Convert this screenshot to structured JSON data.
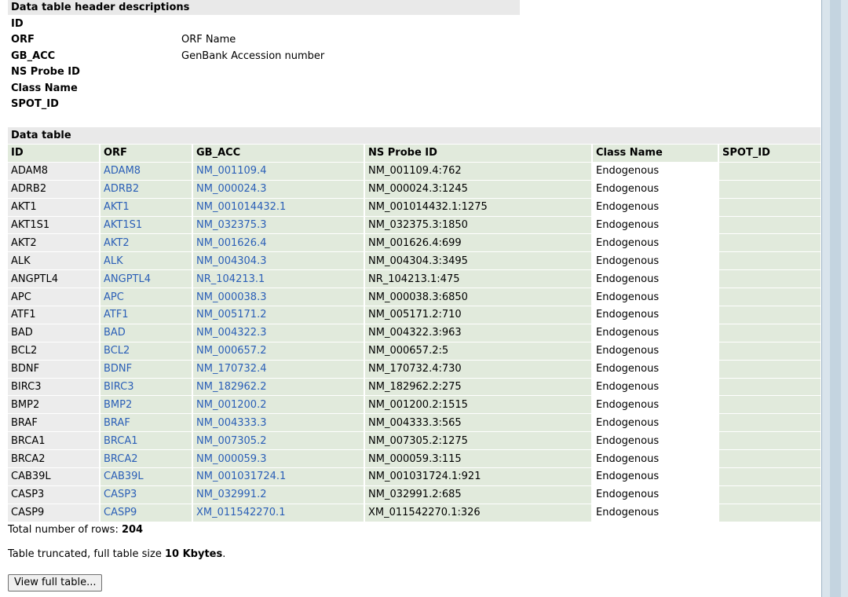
{
  "header_desc": {
    "title": "Data table header descriptions",
    "items": [
      {
        "key": "ID",
        "value": ""
      },
      {
        "key": "ORF",
        "value": "ORF Name"
      },
      {
        "key": "GB_ACC",
        "value": "GenBank Accession number"
      },
      {
        "key": "NS Probe ID",
        "value": ""
      },
      {
        "key": "Class Name",
        "value": ""
      },
      {
        "key": "SPOT_ID",
        "value": ""
      }
    ]
  },
  "data_table": {
    "title": "Data table",
    "columns": [
      "ID",
      "ORF",
      "GB_ACC",
      "NS Probe ID",
      "Class Name",
      "SPOT_ID"
    ],
    "rows": [
      [
        "ADAM8",
        "ADAM8",
        "NM_001109.4",
        "NM_001109.4:762",
        "Endogenous",
        ""
      ],
      [
        "ADRB2",
        "ADRB2",
        "NM_000024.3",
        "NM_000024.3:1245",
        "Endogenous",
        ""
      ],
      [
        "AKT1",
        "AKT1",
        "NM_001014432.1",
        "NM_001014432.1:1275",
        "Endogenous",
        ""
      ],
      [
        "AKT1S1",
        "AKT1S1",
        "NM_032375.3",
        "NM_032375.3:1850",
        "Endogenous",
        ""
      ],
      [
        "AKT2",
        "AKT2",
        "NM_001626.4",
        "NM_001626.4:699",
        "Endogenous",
        ""
      ],
      [
        "ALK",
        "ALK",
        "NM_004304.3",
        "NM_004304.3:3495",
        "Endogenous",
        ""
      ],
      [
        "ANGPTL4",
        "ANGPTL4",
        "NR_104213.1",
        "NR_104213.1:475",
        "Endogenous",
        ""
      ],
      [
        "APC",
        "APC",
        "NM_000038.3",
        "NM_000038.3:6850",
        "Endogenous",
        ""
      ],
      [
        "ATF1",
        "ATF1",
        "NM_005171.2",
        "NM_005171.2:710",
        "Endogenous",
        ""
      ],
      [
        "BAD",
        "BAD",
        "NM_004322.3",
        "NM_004322.3:963",
        "Endogenous",
        ""
      ],
      [
        "BCL2",
        "BCL2",
        "NM_000657.2",
        "NM_000657.2:5",
        "Endogenous",
        ""
      ],
      [
        "BDNF",
        "BDNF",
        "NM_170732.4",
        "NM_170732.4:730",
        "Endogenous",
        ""
      ],
      [
        "BIRC3",
        "BIRC3",
        "NM_182962.2",
        "NM_182962.2:275",
        "Endogenous",
        ""
      ],
      [
        "BMP2",
        "BMP2",
        "NM_001200.2",
        "NM_001200.2:1515",
        "Endogenous",
        ""
      ],
      [
        "BRAF",
        "BRAF",
        "NM_004333.3",
        "NM_004333.3:565",
        "Endogenous",
        ""
      ],
      [
        "BRCA1",
        "BRCA1",
        "NM_007305.2",
        "NM_007305.2:1275",
        "Endogenous",
        ""
      ],
      [
        "BRCA2",
        "BRCA2",
        "NM_000059.3",
        "NM_000059.3:115",
        "Endogenous",
        ""
      ],
      [
        "CAB39L",
        "CAB39L",
        "NM_001031724.1",
        "NM_001031724.1:921",
        "Endogenous",
        ""
      ],
      [
        "CASP3",
        "CASP3",
        "NM_032991.2",
        "NM_032991.2:685",
        "Endogenous",
        ""
      ],
      [
        "CASP9",
        "CASP9",
        "XM_011542270.1",
        "XM_011542270.1:326",
        "Endogenous",
        ""
      ]
    ]
  },
  "footer": {
    "total_prefix": "Total number of rows: ",
    "total_value": "204",
    "trunc_prefix": "Table truncated, full table size ",
    "trunc_value": "10 Kbytes",
    "trunc_suffix": ".",
    "button_label": "View full table..."
  },
  "colors": {
    "link": "#2b5fb7",
    "cell_green": "#e1eadc",
    "cell_gray": "#ececec",
    "section_bar": "#e9e9e9"
  }
}
